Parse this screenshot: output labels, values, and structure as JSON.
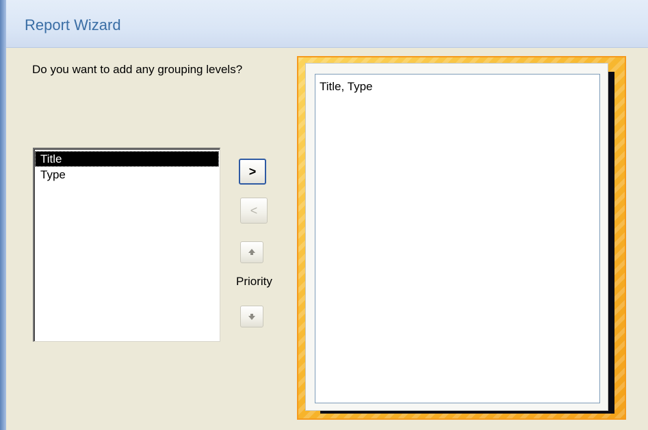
{
  "window": {
    "title": "Report Wizard"
  },
  "prompt": {
    "question": "Do you want to add any grouping levels?"
  },
  "fields": {
    "items": [
      {
        "label": "Title",
        "selected": true
      },
      {
        "label": "Type",
        "selected": false
      }
    ]
  },
  "controls": {
    "add_label": ">",
    "remove_label": "<",
    "priority_label": "Priority",
    "priority_up_icon": "arrow-up-icon",
    "priority_down_icon": "arrow-down-icon"
  },
  "preview": {
    "text": "Title, Type"
  },
  "colors": {
    "title_text": "#3a6ea5",
    "preview_border": "#f59a1d",
    "preview_fill": "#f7b52c",
    "selection_bg": "#000000",
    "dialog_bg": "#ece9d8"
  }
}
